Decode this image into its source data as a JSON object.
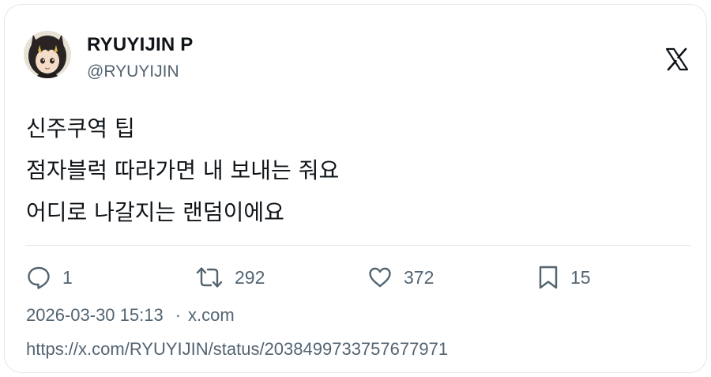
{
  "author": {
    "display_name": "RYUYIJIN P",
    "handle": "@RYUYIJIN",
    "avatar_icon": "anime-avatar-icon"
  },
  "platform": {
    "logo_icon": "x-logo-icon"
  },
  "tweet": {
    "lines": [
      "신주쿠역 팁",
      "점자블럭 따라가면 내 보내는 줘요",
      "어디로 나갈지는 랜덤이에요"
    ]
  },
  "stats": {
    "replies": "1",
    "retweets": "292",
    "likes": "372",
    "bookmarks": "15"
  },
  "meta": {
    "timestamp": "2026-03-30 15:13",
    "separator": "·",
    "source": "x.com",
    "status_url": "https://x.com/RYUYIJIN/status/2038499733757677971"
  },
  "colors": {
    "text_primary": "#0f1419",
    "text_secondary": "#536471",
    "border": "#e3e6e8"
  }
}
